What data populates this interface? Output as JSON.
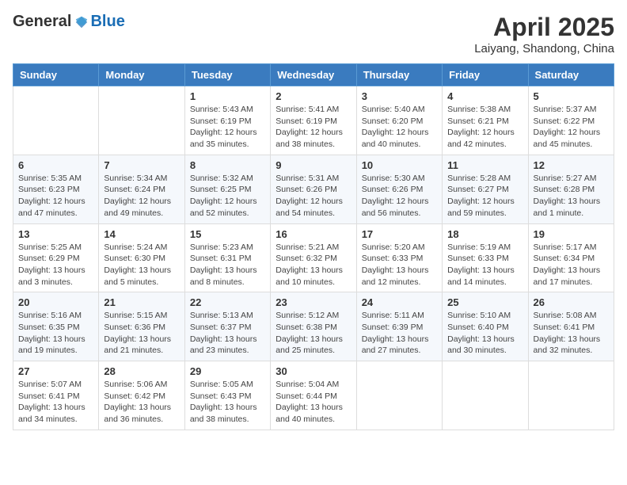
{
  "header": {
    "logo_general": "General",
    "logo_blue": "Blue",
    "month_title": "April 2025",
    "location": "Laiyang, Shandong, China"
  },
  "columns": [
    "Sunday",
    "Monday",
    "Tuesday",
    "Wednesday",
    "Thursday",
    "Friday",
    "Saturday"
  ],
  "weeks": [
    [
      {
        "day": "",
        "info": ""
      },
      {
        "day": "",
        "info": ""
      },
      {
        "day": "1",
        "info": "Sunrise: 5:43 AM\nSunset: 6:19 PM\nDaylight: 12 hours and 35 minutes."
      },
      {
        "day": "2",
        "info": "Sunrise: 5:41 AM\nSunset: 6:19 PM\nDaylight: 12 hours and 38 minutes."
      },
      {
        "day": "3",
        "info": "Sunrise: 5:40 AM\nSunset: 6:20 PM\nDaylight: 12 hours and 40 minutes."
      },
      {
        "day": "4",
        "info": "Sunrise: 5:38 AM\nSunset: 6:21 PM\nDaylight: 12 hours and 42 minutes."
      },
      {
        "day": "5",
        "info": "Sunrise: 5:37 AM\nSunset: 6:22 PM\nDaylight: 12 hours and 45 minutes."
      }
    ],
    [
      {
        "day": "6",
        "info": "Sunrise: 5:35 AM\nSunset: 6:23 PM\nDaylight: 12 hours and 47 minutes."
      },
      {
        "day": "7",
        "info": "Sunrise: 5:34 AM\nSunset: 6:24 PM\nDaylight: 12 hours and 49 minutes."
      },
      {
        "day": "8",
        "info": "Sunrise: 5:32 AM\nSunset: 6:25 PM\nDaylight: 12 hours and 52 minutes."
      },
      {
        "day": "9",
        "info": "Sunrise: 5:31 AM\nSunset: 6:26 PM\nDaylight: 12 hours and 54 minutes."
      },
      {
        "day": "10",
        "info": "Sunrise: 5:30 AM\nSunset: 6:26 PM\nDaylight: 12 hours and 56 minutes."
      },
      {
        "day": "11",
        "info": "Sunrise: 5:28 AM\nSunset: 6:27 PM\nDaylight: 12 hours and 59 minutes."
      },
      {
        "day": "12",
        "info": "Sunrise: 5:27 AM\nSunset: 6:28 PM\nDaylight: 13 hours and 1 minute."
      }
    ],
    [
      {
        "day": "13",
        "info": "Sunrise: 5:25 AM\nSunset: 6:29 PM\nDaylight: 13 hours and 3 minutes."
      },
      {
        "day": "14",
        "info": "Sunrise: 5:24 AM\nSunset: 6:30 PM\nDaylight: 13 hours and 5 minutes."
      },
      {
        "day": "15",
        "info": "Sunrise: 5:23 AM\nSunset: 6:31 PM\nDaylight: 13 hours and 8 minutes."
      },
      {
        "day": "16",
        "info": "Sunrise: 5:21 AM\nSunset: 6:32 PM\nDaylight: 13 hours and 10 minutes."
      },
      {
        "day": "17",
        "info": "Sunrise: 5:20 AM\nSunset: 6:33 PM\nDaylight: 13 hours and 12 minutes."
      },
      {
        "day": "18",
        "info": "Sunrise: 5:19 AM\nSunset: 6:33 PM\nDaylight: 13 hours and 14 minutes."
      },
      {
        "day": "19",
        "info": "Sunrise: 5:17 AM\nSunset: 6:34 PM\nDaylight: 13 hours and 17 minutes."
      }
    ],
    [
      {
        "day": "20",
        "info": "Sunrise: 5:16 AM\nSunset: 6:35 PM\nDaylight: 13 hours and 19 minutes."
      },
      {
        "day": "21",
        "info": "Sunrise: 5:15 AM\nSunset: 6:36 PM\nDaylight: 13 hours and 21 minutes."
      },
      {
        "day": "22",
        "info": "Sunrise: 5:13 AM\nSunset: 6:37 PM\nDaylight: 13 hours and 23 minutes."
      },
      {
        "day": "23",
        "info": "Sunrise: 5:12 AM\nSunset: 6:38 PM\nDaylight: 13 hours and 25 minutes."
      },
      {
        "day": "24",
        "info": "Sunrise: 5:11 AM\nSunset: 6:39 PM\nDaylight: 13 hours and 27 minutes."
      },
      {
        "day": "25",
        "info": "Sunrise: 5:10 AM\nSunset: 6:40 PM\nDaylight: 13 hours and 30 minutes."
      },
      {
        "day": "26",
        "info": "Sunrise: 5:08 AM\nSunset: 6:41 PM\nDaylight: 13 hours and 32 minutes."
      }
    ],
    [
      {
        "day": "27",
        "info": "Sunrise: 5:07 AM\nSunset: 6:41 PM\nDaylight: 13 hours and 34 minutes."
      },
      {
        "day": "28",
        "info": "Sunrise: 5:06 AM\nSunset: 6:42 PM\nDaylight: 13 hours and 36 minutes."
      },
      {
        "day": "29",
        "info": "Sunrise: 5:05 AM\nSunset: 6:43 PM\nDaylight: 13 hours and 38 minutes."
      },
      {
        "day": "30",
        "info": "Sunrise: 5:04 AM\nSunset: 6:44 PM\nDaylight: 13 hours and 40 minutes."
      },
      {
        "day": "",
        "info": ""
      },
      {
        "day": "",
        "info": ""
      },
      {
        "day": "",
        "info": ""
      }
    ]
  ]
}
